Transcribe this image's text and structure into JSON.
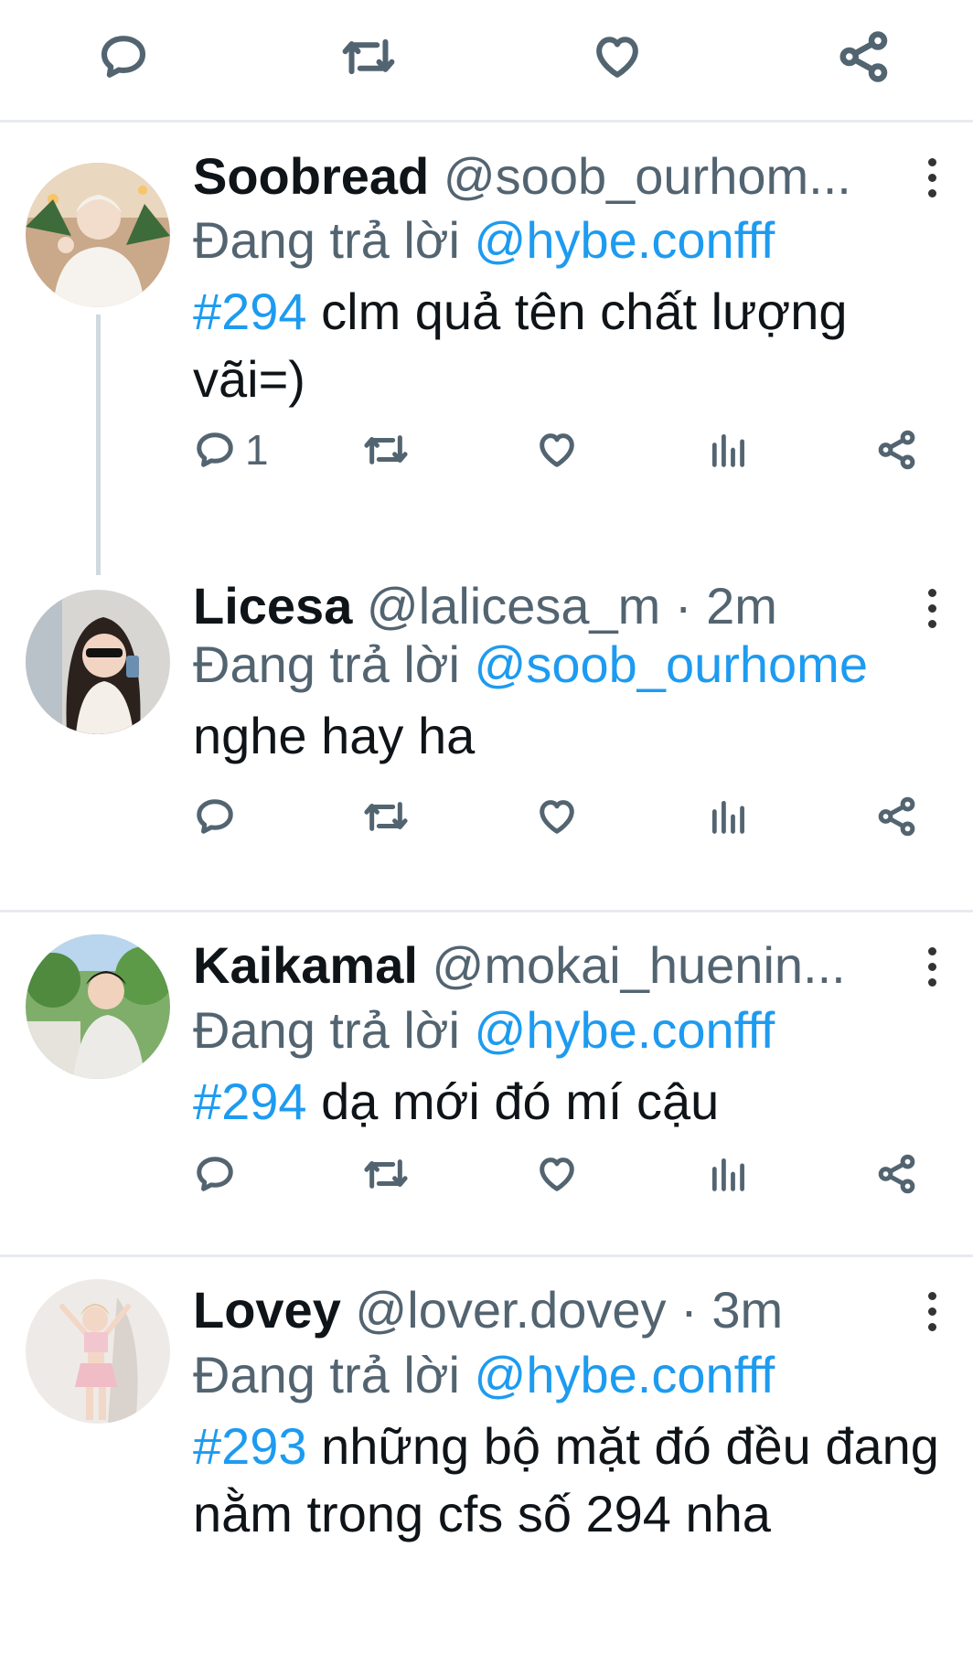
{
  "tweets": [
    {
      "name": "Soobread",
      "handle": "@soob_ourhom...",
      "reply_label": "Đang trả lời",
      "reply_to": "@hybe.confff",
      "hashtag": "#294",
      "text": " clm quả tên chất lượng vãi=)",
      "reply_count": "1"
    },
    {
      "name": "Licesa",
      "handle": "@lalicesa_m · 2m",
      "reply_label": "Đang trả lời",
      "reply_to": "@soob_ourhome",
      "hashtag": "",
      "text": "nghe hay ha",
      "reply_count": ""
    },
    {
      "name": "Kaikamal",
      "handle": "@mokai_huenin...",
      "reply_label": "Đang trả lời",
      "reply_to": "@hybe.confff",
      "hashtag": "#294",
      "text": " dạ mới đó mí cậu",
      "reply_count": ""
    },
    {
      "name": "Lovey",
      "handle": "@lover.dovey · 3m",
      "reply_label": "Đang trả lời",
      "reply_to": "@hybe.confff",
      "hashtag": "#293",
      "text": " những bộ mặt đó đều đang nằm trong cfs số 294 nha",
      "reply_count": ""
    }
  ],
  "icons": {
    "reply": "reply-icon",
    "retweet": "retweet-icon",
    "like": "heart-icon",
    "views": "views-icon",
    "share": "share-icon",
    "more": "more-icon"
  },
  "colors": {
    "link": "#1d9bf0",
    "secondary_text": "#536471",
    "divider": "#e7eaee"
  }
}
